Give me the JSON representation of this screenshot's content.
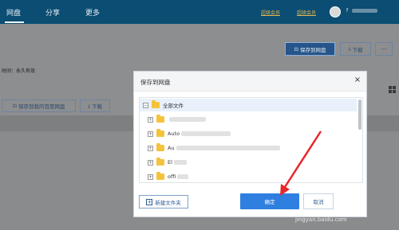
{
  "topbar": {
    "nav": [
      "网盘",
      "分享",
      "更多"
    ],
    "vip_label": "超级会员",
    "vip2_label": "超级会员",
    "username": "f"
  },
  "toolbar": {
    "save_top_label": "保存到网盘",
    "download_top_label": "下载",
    "save_left_label": "保存到我的百度网盘",
    "download_left_label": "下载"
  },
  "page": {
    "validity_text": "时间：永久有效"
  },
  "dialog": {
    "title": "保存到网盘",
    "close": "×",
    "root_label": "全部文件",
    "folders": [
      "",
      "Auto",
      "Au",
      "El",
      "offi"
    ],
    "new_folder_label": "新建文件夹",
    "ok_label": "确定",
    "cancel_label": "取消"
  },
  "watermark": {
    "brand": "Bai",
    "url": "jingyan.baidu.com"
  },
  "colors": {
    "topbar": "#0b4d73",
    "primary": "#2f7fe0",
    "folder": "#f5c33b",
    "arrow": "#e8262b"
  }
}
